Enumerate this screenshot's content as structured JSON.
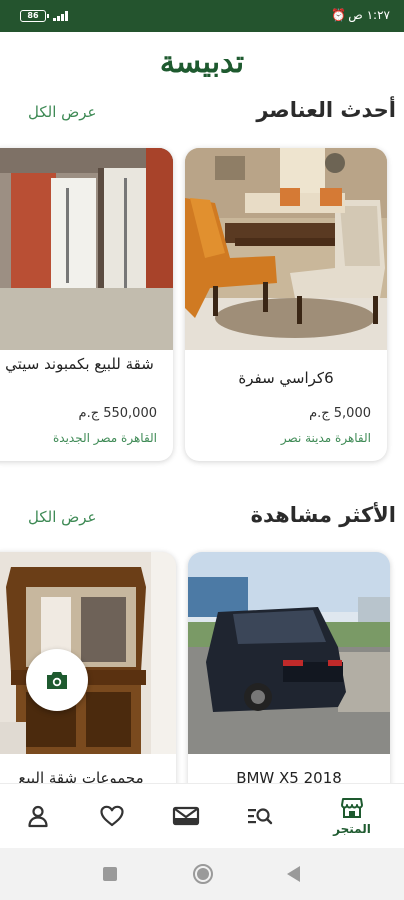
{
  "status_bar": {
    "time": "١:٢٧ ص",
    "battery": "86"
  },
  "app": {
    "title": "تدبيسة"
  },
  "sections": [
    {
      "title": "أحدث العناصر",
      "view_all": "عرض الكل",
      "items": [
        {
          "title": "6كراسي سفرة",
          "price": "5,000 ج.م",
          "location": "القاهرة  مدينة نصر"
        },
        {
          "title": "شقة للبيع بكمبوند سيتي",
          "price": "550,000 ج.م",
          "location": "القاهرة  مصر الجديدة"
        }
      ]
    },
    {
      "title": "الأكثر مشاهدة",
      "view_all": "عرض الكل",
      "items": [
        {
          "title": "BMW X5 2018"
        },
        {
          "title": "مجموعات شقة البيع"
        }
      ]
    }
  ],
  "bottom_nav": {
    "store_label": "المتجر",
    "icons": [
      "store-icon",
      "search-list-icon",
      "messages-icon",
      "favorites-icon",
      "profile-icon"
    ]
  },
  "colors": {
    "brand": "#1e5a2f",
    "accent": "#3e8a55",
    "status_bar": "#24542e"
  }
}
